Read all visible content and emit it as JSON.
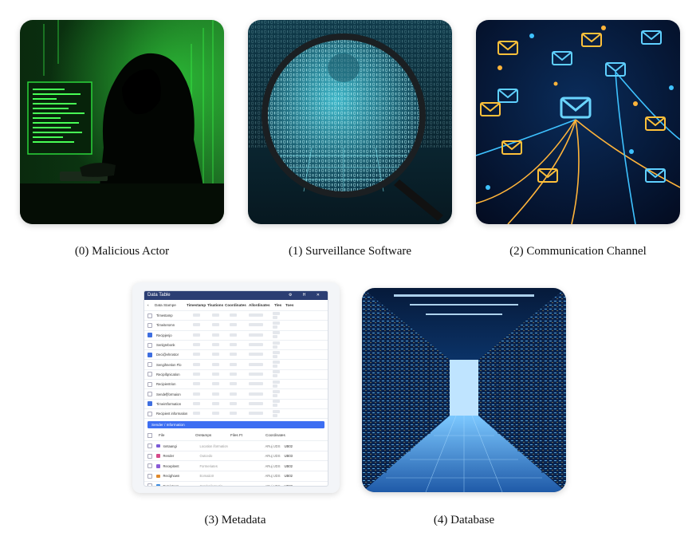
{
  "items": [
    {
      "caption": "(0) Malicious Actor"
    },
    {
      "caption": "(1) Surveillance Software"
    },
    {
      "caption": "(2) Communication Channel"
    },
    {
      "caption": "(3) Metadata"
    },
    {
      "caption": "(4) Database"
    }
  ],
  "metadata_panel": {
    "title": "Data Table",
    "header": [
      "Data Stampe",
      "Timestamp",
      "Tlsations",
      "Coordinates",
      "Allordinates",
      "Tles",
      "Toes"
    ],
    "rows": [
      {
        "name": "Timestamp",
        "checked": false
      },
      {
        "name": "Timeiteromn",
        "checked": false
      },
      {
        "name": "Recipjenjo",
        "checked": true
      },
      {
        "name": "Senlgrebonk",
        "checked": false
      },
      {
        "name": "Deci@ehrostor",
        "checked": true
      },
      {
        "name": "Sengihnetion Flo",
        "checked": false
      },
      {
        "name": "Recipifqnication",
        "checked": false
      },
      {
        "name": "Recipientrion",
        "checked": false
      },
      {
        "name": "Sendef|formaion",
        "checked": false
      },
      {
        "name": "Timeintformation",
        "checked": true
      },
      {
        "name": "Recipient information",
        "checked": false
      }
    ],
    "section_title": "Sender / Information",
    "section_header": [
      "File",
      "Oretamps",
      "Files Ft",
      "Coordinates"
    ],
    "section_rows": [
      {
        "name": "Iontaangi",
        "value": "Location iformation",
        "unit": "ARuj UDS",
        "code": "UB02",
        "color": "#7a5bd6"
      },
      {
        "name": "Render",
        "value": "Outcedo",
        "unit": "ARuj UDS",
        "code": "UB03",
        "color": "#d64a8a"
      },
      {
        "name": "Recepitent",
        "value": "Formeriates",
        "unit": "ARuj UDS",
        "code": "UB02",
        "color": "#8a5bd6"
      },
      {
        "name": "Recighown",
        "value": "Eomaiiotr",
        "unit": "ARuj UDS",
        "code": "UB02",
        "color": "#e08a2c"
      },
      {
        "name": "Evmietaon",
        "value": "Gsrdet formatin",
        "unit": "ARuj UDS",
        "code": "UB02",
        "color": "#3d8de0"
      }
    ]
  }
}
